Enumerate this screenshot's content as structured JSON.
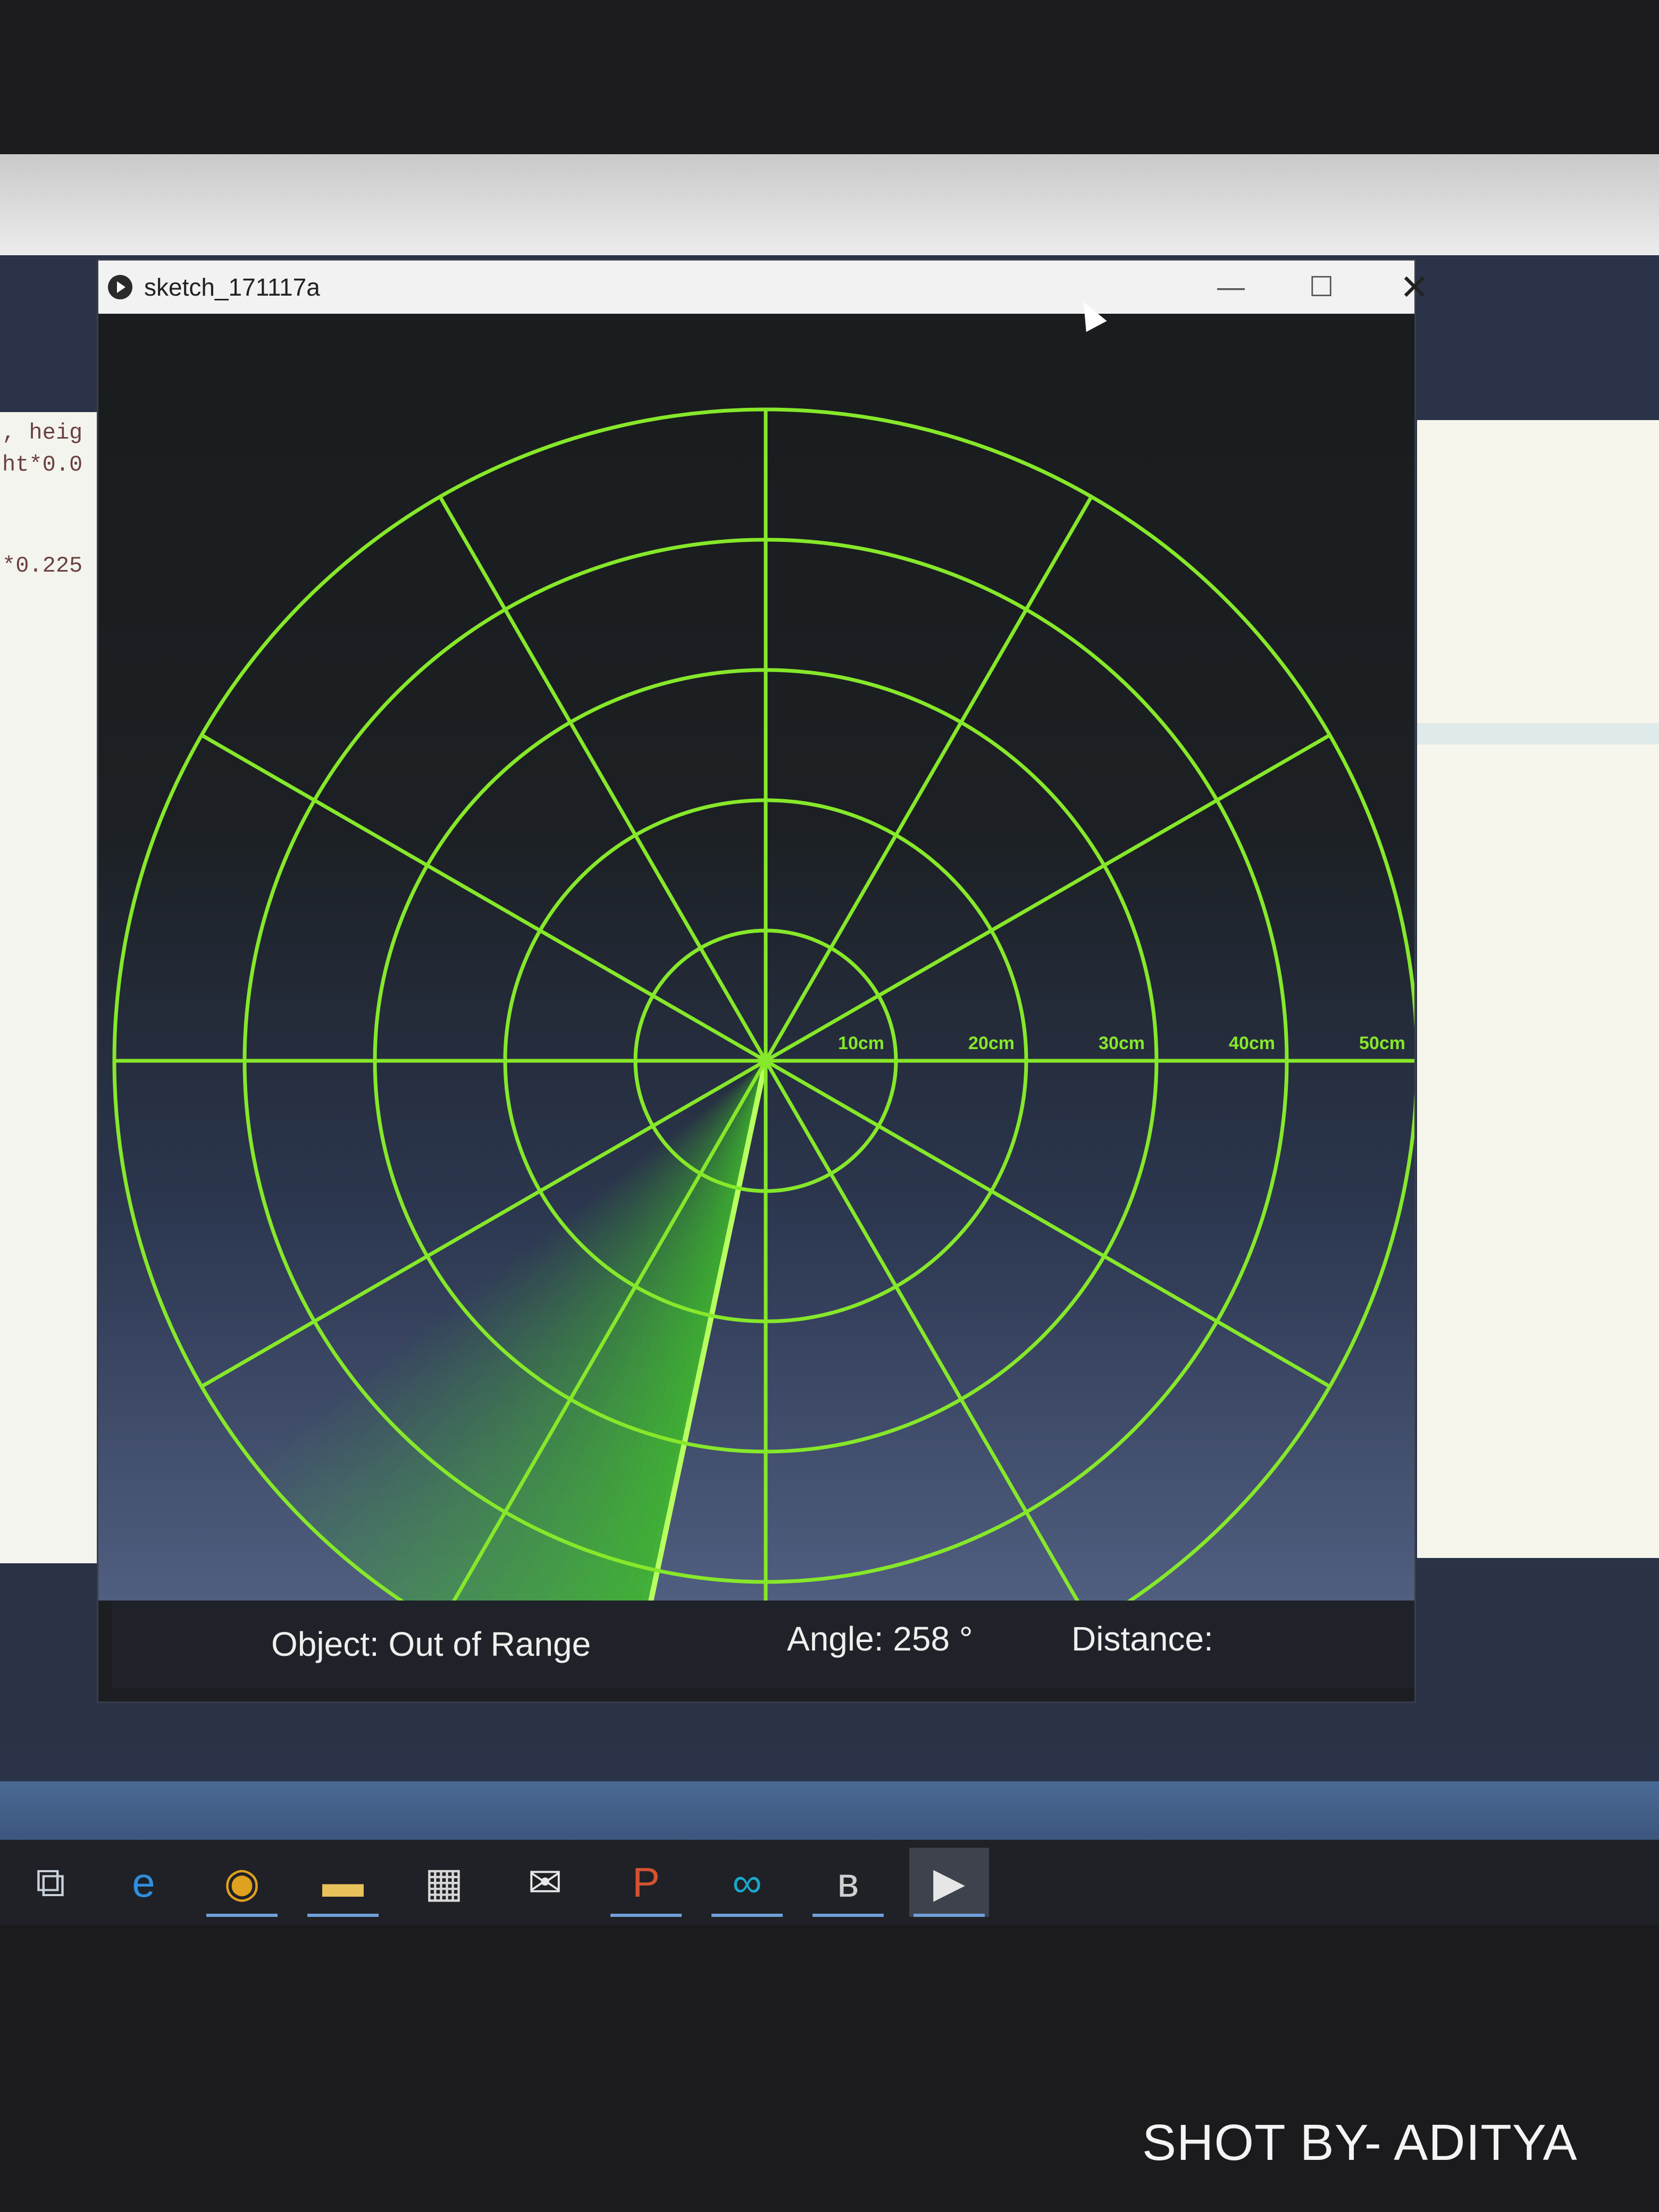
{
  "window": {
    "title": "sketch_171117a",
    "minimize_label": "—",
    "maximize_label": "☐",
    "close_label": "✕"
  },
  "editor": {
    "line_1": ", heig",
    "line_2": "ht*0.0",
    "line_3": "*0.225"
  },
  "radar": {
    "rings": [
      "10cm",
      "20cm",
      "30cm",
      "40cm",
      "50cm"
    ],
    "spoke_angles_deg": [
      0,
      30,
      60,
      90,
      120,
      150,
      180,
      210,
      240,
      270,
      300,
      330
    ],
    "sweep_angle_deg": 258,
    "trail_span_deg": 40,
    "grid_color": "#86e82a",
    "sweep_color": "#3fbf2a"
  },
  "status": {
    "object": "Object: Out of Range",
    "angle": "Angle: 258 °",
    "distance": "Distance:"
  },
  "taskbar": {
    "items": [
      {
        "name": "task-view-icon",
        "glyph": "⧉",
        "color": "#c9d0da"
      },
      {
        "name": "edge-icon",
        "glyph": "e",
        "color": "#2f8fe0"
      },
      {
        "name": "chrome-icon",
        "glyph": "◉",
        "color": "#e0a020"
      },
      {
        "name": "file-explorer-icon",
        "glyph": "▬",
        "color": "#e8c25a"
      },
      {
        "name": "store-icon",
        "glyph": "▦",
        "color": "#d8d8d8"
      },
      {
        "name": "mail-icon",
        "glyph": "✉",
        "color": "#e8e8e8"
      },
      {
        "name": "powerpoint-icon",
        "glyph": "P",
        "color": "#d35230"
      },
      {
        "name": "arduino-icon",
        "glyph": "∞",
        "color": "#19a7c9"
      },
      {
        "name": "app-icon-b",
        "glyph": "ʙ",
        "color": "#cfcfcf"
      },
      {
        "name": "processing-icon",
        "glyph": "▶",
        "color": "#e6e6e6"
      }
    ]
  },
  "watermark": "SHOT BY- ADITYA"
}
